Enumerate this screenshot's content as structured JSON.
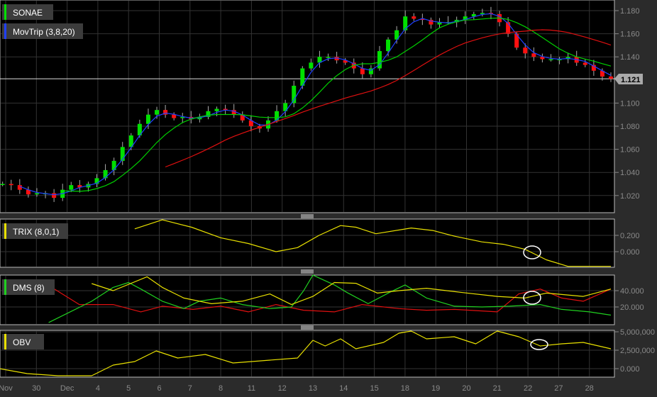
{
  "symbol": "SONAE",
  "last_price": "1.121",
  "legends": {
    "price": "SONAE",
    "ma": "MovTrip (3,8,20)",
    "trix": "TRIX (8,0,1)",
    "dms": "DMS (8)",
    "obv": "OBV"
  },
  "colors": {
    "up": "#00e000",
    "down": "#ff1010",
    "ma_fast": "#2040ff",
    "ma_mid": "#00d000",
    "ma_slow": "#e01010",
    "trix": "#e8e000",
    "dms_adx": "#e8e000",
    "dms_plus": "#20d020",
    "dms_minus": "#e01010",
    "obv": "#e8e000",
    "bg": "#2b2b2b",
    "plot": "#000000"
  },
  "chart_data": {
    "type": "line",
    "x_ticks": [
      "Nov",
      "30",
      "Dec",
      "4",
      "5",
      "6",
      "7",
      "8",
      "11",
      "12",
      "13",
      "14",
      "15",
      "18",
      "19",
      "20",
      "21",
      "22",
      "27",
      "28"
    ],
    "price": {
      "type": "candlestick",
      "day_range": [
        -0.1,
        19.7
      ],
      "y_ticks": [
        "1.180",
        "1.160",
        "1.140",
        "1.100",
        "1.080",
        "1.060",
        "1.040",
        "1.020"
      ],
      "ylim": [
        1.01,
        1.19
      ],
      "closes": [
        1.03,
        1.029,
        1.025,
        1.021,
        1.022,
        1.022,
        1.018,
        1.025,
        1.029,
        1.027,
        1.03,
        1.035,
        1.042,
        1.05,
        1.062,
        1.072,
        1.082,
        1.09,
        1.094,
        1.09,
        1.087,
        1.088,
        1.086,
        1.088,
        1.093,
        1.095,
        1.094,
        1.09,
        1.085,
        1.08,
        1.078,
        1.085,
        1.093,
        1.1,
        1.115,
        1.13,
        1.135,
        1.14,
        1.14,
        1.137,
        1.135,
        1.13,
        1.125,
        1.13,
        1.145,
        1.155,
        1.163,
        1.175,
        1.173,
        1.172,
        1.168,
        1.17,
        1.17,
        1.172,
        1.175,
        1.177,
        1.178,
        1.177,
        1.17,
        1.16,
        1.148,
        1.143,
        1.14,
        1.138,
        1.138,
        1.138,
        1.14,
        1.135,
        1.133,
        1.128,
        1.123,
        1.121
      ],
      "ma_periods": [
        3,
        8,
        20
      ]
    },
    "trix": {
      "y_ticks": [
        "0.200",
        "0.000"
      ],
      "ylim": [
        -0.2,
        0.4
      ],
      "points": [
        [
          4.2,
          0.28
        ],
        [
          5.1,
          0.39
        ],
        [
          6.05,
          0.3
        ],
        [
          7.0,
          0.17
        ],
        [
          7.9,
          0.1
        ],
        [
          8.8,
          0.0
        ],
        [
          9.5,
          0.05
        ],
        [
          10.2,
          0.2
        ],
        [
          10.9,
          0.32
        ],
        [
          11.4,
          0.3
        ],
        [
          12.05,
          0.22
        ],
        [
          13.2,
          0.29
        ],
        [
          13.9,
          0.26
        ],
        [
          14.6,
          0.19
        ],
        [
          15.5,
          0.12
        ],
        [
          16.2,
          0.09
        ],
        [
          16.9,
          0.03
        ],
        [
          17.6,
          -0.1
        ],
        [
          18.3,
          -0.18
        ],
        [
          19.7,
          -0.18
        ]
      ]
    },
    "dms": {
      "y_ticks": [
        "40.000",
        "20.000"
      ],
      "ylim": [
        0,
        60
      ],
      "adx": [
        [
          2.8,
          48.7
        ],
        [
          3.5,
          40
        ],
        [
          4.6,
          57
        ],
        [
          5.1,
          44
        ],
        [
          5.8,
          31
        ],
        [
          6.7,
          24
        ],
        [
          7.7,
          27
        ],
        [
          8.6,
          36
        ],
        [
          9.3,
          23
        ],
        [
          10.0,
          33
        ],
        [
          10.7,
          50
        ],
        [
          11.4,
          49
        ],
        [
          12.1,
          37
        ],
        [
          12.8,
          40
        ],
        [
          13.7,
          43
        ],
        [
          14.8,
          38
        ],
        [
          16.0,
          33
        ],
        [
          16.9,
          31
        ],
        [
          17.6,
          37
        ],
        [
          18.8,
          33
        ],
        [
          19.7,
          42
        ]
      ],
      "plus_di": [
        [
          1.4,
          1
        ],
        [
          2.1,
          14
        ],
        [
          2.8,
          27
        ],
        [
          3.5,
          44
        ],
        [
          4.0,
          50
        ],
        [
          4.4,
          42
        ],
        [
          5.1,
          27
        ],
        [
          5.8,
          18
        ],
        [
          6.3,
          27
        ],
        [
          7.0,
          31
        ],
        [
          7.7,
          23
        ],
        [
          8.6,
          18
        ],
        [
          9.3,
          20
        ],
        [
          9.7,
          40
        ],
        [
          10.0,
          59
        ],
        [
          10.7,
          47
        ],
        [
          11.1,
          38
        ],
        [
          11.8,
          24
        ],
        [
          12.5,
          38
        ],
        [
          13.0,
          47
        ],
        [
          13.7,
          31
        ],
        [
          14.6,
          21
        ],
        [
          15.5,
          20
        ],
        [
          16.4,
          21
        ],
        [
          17.4,
          23
        ],
        [
          18.1,
          17
        ],
        [
          19.0,
          14
        ],
        [
          19.7,
          10
        ]
      ],
      "minus_di": [
        [
          1.5,
          44
        ],
        [
          2.4,
          23
        ],
        [
          2.8,
          23
        ],
        [
          3.5,
          23
        ],
        [
          4.4,
          14
        ],
        [
          5.1,
          21
        ],
        [
          6.1,
          17
        ],
        [
          7.0,
          21
        ],
        [
          7.9,
          14
        ],
        [
          8.8,
          23
        ],
        [
          9.7,
          16
        ],
        [
          10.7,
          14
        ],
        [
          11.6,
          23
        ],
        [
          12.8,
          18
        ],
        [
          13.7,
          16
        ],
        [
          14.6,
          17
        ],
        [
          16.0,
          14
        ],
        [
          16.7,
          36
        ],
        [
          17.4,
          42
        ],
        [
          18.1,
          31
        ],
        [
          18.8,
          27
        ],
        [
          19.7,
          42
        ]
      ]
    },
    "obv": {
      "y_ticks": [
        "5,000,000",
        "2,500,000",
        "0.000"
      ],
      "ylim": [
        -1000000,
        5300000
      ],
      "points": [
        [
          -0.2,
          0
        ],
        [
          0.7,
          -670000
        ],
        [
          1.7,
          -960000
        ],
        [
          2.8,
          -960000
        ],
        [
          3.5,
          480000
        ],
        [
          4.2,
          960000
        ],
        [
          4.9,
          2400000
        ],
        [
          5.6,
          1440000
        ],
        [
          6.5,
          1920000
        ],
        [
          7.4,
          770000
        ],
        [
          8.6,
          1150000
        ],
        [
          9.5,
          1440000
        ],
        [
          10.0,
          3850000
        ],
        [
          10.4,
          3080000
        ],
        [
          10.9,
          4040000
        ],
        [
          11.4,
          2690000
        ],
        [
          12.3,
          3560000
        ],
        [
          12.8,
          4810000
        ],
        [
          13.2,
          5100000
        ],
        [
          13.7,
          4040000
        ],
        [
          14.6,
          4330000
        ],
        [
          15.3,
          3370000
        ],
        [
          16.0,
          5100000
        ],
        [
          16.7,
          4330000
        ],
        [
          17.4,
          3080000
        ],
        [
          18.1,
          3370000
        ],
        [
          18.8,
          3560000
        ],
        [
          19.7,
          2690000
        ]
      ]
    }
  }
}
